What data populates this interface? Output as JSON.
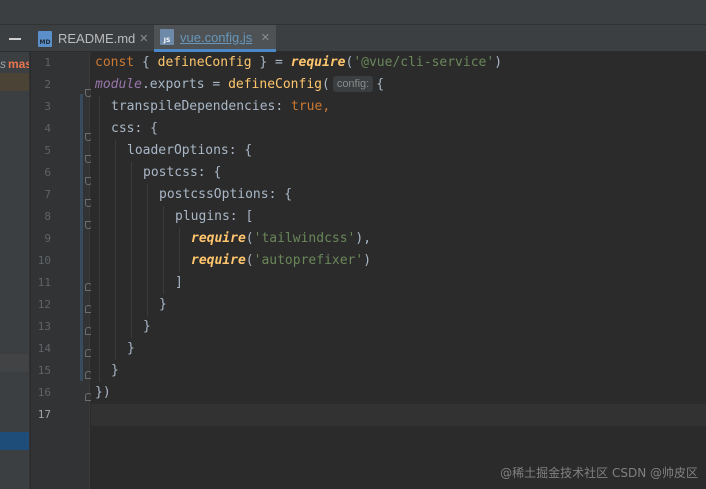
{
  "tabs": [
    {
      "name": "README.md",
      "icon": "markdown-file-icon",
      "active": false
    },
    {
      "name": "vue.config.js",
      "icon": "javascript-file-icon",
      "active": true
    }
  ],
  "close_glyph": "✕",
  "left_panel": {
    "branch_prefix": "s",
    "branch_name": "mas"
  },
  "line_numbers": [
    "1",
    "2",
    "3",
    "4",
    "5",
    "6",
    "7",
    "8",
    "9",
    "10",
    "11",
    "12",
    "13",
    "14",
    "15",
    "16",
    "17"
  ],
  "current_line": "17",
  "inlay_hint": "config:",
  "code": {
    "l1": {
      "kw": "const ",
      "brace_open": "{ ",
      "name": "defineConfig",
      "brace_close": " } = ",
      "req": "require",
      "paren_open": "(",
      "str": "'@vue/cli-service'",
      "paren_close": ")"
    },
    "l2": {
      "obj": "module",
      "rest": ".exports = ",
      "fn": "defineConfig",
      "paren": "(",
      "brace": "{"
    },
    "l3": {
      "key": "transpileDependencies",
      "colon": ": ",
      "val": "true",
      "comma": ","
    },
    "l4": "css: {",
    "l5": "loaderOptions: {",
    "l6": "postcss: {",
    "l7": "postcssOptions: {",
    "l8": "plugins: [",
    "l9": {
      "req": "require",
      "open": "(",
      "str": "'tailwindcss'",
      "close": "),"
    },
    "l10": {
      "req": "require",
      "open": "(",
      "str": "'autoprefixer'",
      "close": ")"
    },
    "l11": "]",
    "l12": "}",
    "l13": "}",
    "l14": "}",
    "l15": "}",
    "l16": "})"
  },
  "watermark": "@稀土掘金技术社区 CSDN @帅皮区",
  "colors": {
    "background": "#2b2b2b",
    "keyword": "#cc7832",
    "string": "#6a8759",
    "function": "#ffc66d",
    "text": "#a9b7c6",
    "active_tab_text": "#6897bb"
  }
}
